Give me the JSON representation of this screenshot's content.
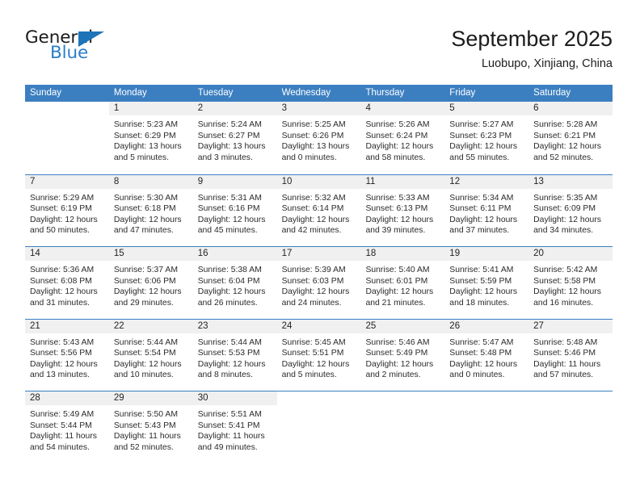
{
  "brand": {
    "name_top": "General",
    "name_bottom": "Blue",
    "accent_color": "#2a7fc9",
    "triangle_color": "#1f74b8"
  },
  "header": {
    "title": "September 2025",
    "subtitle": "Luobupo, Xinjiang, China"
  },
  "calendar": {
    "header_bg": "#3c7fc1",
    "day_strip_bg": "#f0f0f0",
    "weekdays": [
      "Sunday",
      "Monday",
      "Tuesday",
      "Wednesday",
      "Thursday",
      "Friday",
      "Saturday"
    ],
    "weeks": [
      [
        {
          "day": "",
          "lines": []
        },
        {
          "day": "1",
          "lines": [
            "Sunrise: 5:23 AM",
            "Sunset: 6:29 PM",
            "Daylight: 13 hours",
            "and 5 minutes."
          ]
        },
        {
          "day": "2",
          "lines": [
            "Sunrise: 5:24 AM",
            "Sunset: 6:27 PM",
            "Daylight: 13 hours",
            "and 3 minutes."
          ]
        },
        {
          "day": "3",
          "lines": [
            "Sunrise: 5:25 AM",
            "Sunset: 6:26 PM",
            "Daylight: 13 hours",
            "and 0 minutes."
          ]
        },
        {
          "day": "4",
          "lines": [
            "Sunrise: 5:26 AM",
            "Sunset: 6:24 PM",
            "Daylight: 12 hours",
            "and 58 minutes."
          ]
        },
        {
          "day": "5",
          "lines": [
            "Sunrise: 5:27 AM",
            "Sunset: 6:23 PM",
            "Daylight: 12 hours",
            "and 55 minutes."
          ]
        },
        {
          "day": "6",
          "lines": [
            "Sunrise: 5:28 AM",
            "Sunset: 6:21 PM",
            "Daylight: 12 hours",
            "and 52 minutes."
          ]
        }
      ],
      [
        {
          "day": "7",
          "lines": [
            "Sunrise: 5:29 AM",
            "Sunset: 6:19 PM",
            "Daylight: 12 hours",
            "and 50 minutes."
          ]
        },
        {
          "day": "8",
          "lines": [
            "Sunrise: 5:30 AM",
            "Sunset: 6:18 PM",
            "Daylight: 12 hours",
            "and 47 minutes."
          ]
        },
        {
          "day": "9",
          "lines": [
            "Sunrise: 5:31 AM",
            "Sunset: 6:16 PM",
            "Daylight: 12 hours",
            "and 45 minutes."
          ]
        },
        {
          "day": "10",
          "lines": [
            "Sunrise: 5:32 AM",
            "Sunset: 6:14 PM",
            "Daylight: 12 hours",
            "and 42 minutes."
          ]
        },
        {
          "day": "11",
          "lines": [
            "Sunrise: 5:33 AM",
            "Sunset: 6:13 PM",
            "Daylight: 12 hours",
            "and 39 minutes."
          ]
        },
        {
          "day": "12",
          "lines": [
            "Sunrise: 5:34 AM",
            "Sunset: 6:11 PM",
            "Daylight: 12 hours",
            "and 37 minutes."
          ]
        },
        {
          "day": "13",
          "lines": [
            "Sunrise: 5:35 AM",
            "Sunset: 6:09 PM",
            "Daylight: 12 hours",
            "and 34 minutes."
          ]
        }
      ],
      [
        {
          "day": "14",
          "lines": [
            "Sunrise: 5:36 AM",
            "Sunset: 6:08 PM",
            "Daylight: 12 hours",
            "and 31 minutes."
          ]
        },
        {
          "day": "15",
          "lines": [
            "Sunrise: 5:37 AM",
            "Sunset: 6:06 PM",
            "Daylight: 12 hours",
            "and 29 minutes."
          ]
        },
        {
          "day": "16",
          "lines": [
            "Sunrise: 5:38 AM",
            "Sunset: 6:04 PM",
            "Daylight: 12 hours",
            "and 26 minutes."
          ]
        },
        {
          "day": "17",
          "lines": [
            "Sunrise: 5:39 AM",
            "Sunset: 6:03 PM",
            "Daylight: 12 hours",
            "and 24 minutes."
          ]
        },
        {
          "day": "18",
          "lines": [
            "Sunrise: 5:40 AM",
            "Sunset: 6:01 PM",
            "Daylight: 12 hours",
            "and 21 minutes."
          ]
        },
        {
          "day": "19",
          "lines": [
            "Sunrise: 5:41 AM",
            "Sunset: 5:59 PM",
            "Daylight: 12 hours",
            "and 18 minutes."
          ]
        },
        {
          "day": "20",
          "lines": [
            "Sunrise: 5:42 AM",
            "Sunset: 5:58 PM",
            "Daylight: 12 hours",
            "and 16 minutes."
          ]
        }
      ],
      [
        {
          "day": "21",
          "lines": [
            "Sunrise: 5:43 AM",
            "Sunset: 5:56 PM",
            "Daylight: 12 hours",
            "and 13 minutes."
          ]
        },
        {
          "day": "22",
          "lines": [
            "Sunrise: 5:44 AM",
            "Sunset: 5:54 PM",
            "Daylight: 12 hours",
            "and 10 minutes."
          ]
        },
        {
          "day": "23",
          "lines": [
            "Sunrise: 5:44 AM",
            "Sunset: 5:53 PM",
            "Daylight: 12 hours",
            "and 8 minutes."
          ]
        },
        {
          "day": "24",
          "lines": [
            "Sunrise: 5:45 AM",
            "Sunset: 5:51 PM",
            "Daylight: 12 hours",
            "and 5 minutes."
          ]
        },
        {
          "day": "25",
          "lines": [
            "Sunrise: 5:46 AM",
            "Sunset: 5:49 PM",
            "Daylight: 12 hours",
            "and 2 minutes."
          ]
        },
        {
          "day": "26",
          "lines": [
            "Sunrise: 5:47 AM",
            "Sunset: 5:48 PM",
            "Daylight: 12 hours",
            "and 0 minutes."
          ]
        },
        {
          "day": "27",
          "lines": [
            "Sunrise: 5:48 AM",
            "Sunset: 5:46 PM",
            "Daylight: 11 hours",
            "and 57 minutes."
          ]
        }
      ],
      [
        {
          "day": "28",
          "lines": [
            "Sunrise: 5:49 AM",
            "Sunset: 5:44 PM",
            "Daylight: 11 hours",
            "and 54 minutes."
          ]
        },
        {
          "day": "29",
          "lines": [
            "Sunrise: 5:50 AM",
            "Sunset: 5:43 PM",
            "Daylight: 11 hours",
            "and 52 minutes."
          ]
        },
        {
          "day": "30",
          "lines": [
            "Sunrise: 5:51 AM",
            "Sunset: 5:41 PM",
            "Daylight: 11 hours",
            "and 49 minutes."
          ]
        },
        {
          "day": "",
          "lines": []
        },
        {
          "day": "",
          "lines": []
        },
        {
          "day": "",
          "lines": []
        },
        {
          "day": "",
          "lines": []
        }
      ]
    ]
  }
}
